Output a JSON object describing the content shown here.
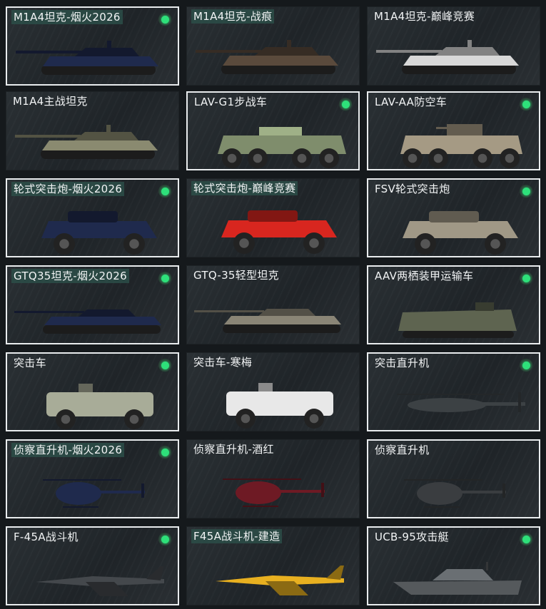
{
  "cards": [
    {
      "label": "M1A4坦克-烟火2026",
      "owned": true,
      "selected": true,
      "highlight": true,
      "icon": "tank-icon",
      "skin": "firework",
      "accent": "#1f2a4d"
    },
    {
      "label": "M1A4坦克-战痕",
      "owned": false,
      "selected": false,
      "highlight": true,
      "icon": "tank-icon",
      "skin": "battlescar",
      "accent": "#5a4a3c"
    },
    {
      "label": "M1A4坦克-巅峰竞赛",
      "owned": false,
      "selected": false,
      "highlight": false,
      "icon": "tank-icon",
      "skin": "race",
      "accent": "#d8d8d8"
    },
    {
      "label": "M1A4主战坦克",
      "owned": false,
      "selected": false,
      "highlight": false,
      "icon": "tank-icon",
      "skin": "default",
      "accent": "#8a8a70"
    },
    {
      "label": "LAV-G1步战车",
      "owned": true,
      "selected": true,
      "highlight": false,
      "icon": "ifv-icon",
      "skin": "default",
      "accent": "#7f8d6c"
    },
    {
      "label": "LAV-AA防空车",
      "owned": true,
      "selected": true,
      "highlight": false,
      "icon": "aa-vehicle-icon",
      "skin": "default",
      "accent": "#a59a84"
    },
    {
      "label": "轮式突击炮-烟火2026",
      "owned": true,
      "selected": true,
      "highlight": true,
      "icon": "armored-car-icon",
      "skin": "firework",
      "accent": "#1f2a4d"
    },
    {
      "label": "轮式突击炮-巅峰竞赛",
      "owned": false,
      "selected": false,
      "highlight": true,
      "icon": "armored-car-icon",
      "skin": "race",
      "accent": "#d8261f"
    },
    {
      "label": "FSV轮式突击炮",
      "owned": true,
      "selected": true,
      "highlight": false,
      "icon": "armored-car-icon",
      "skin": "default",
      "accent": "#a09886"
    },
    {
      "label": "GTQ35坦克-烟火2026",
      "owned": true,
      "selected": true,
      "highlight": true,
      "icon": "light-tank-icon",
      "skin": "firework",
      "accent": "#1f2a4d"
    },
    {
      "label": "GTQ-35轻型坦克",
      "owned": false,
      "selected": false,
      "highlight": false,
      "icon": "light-tank-icon",
      "skin": "default",
      "accent": "#8a8576"
    },
    {
      "label": "AAV两栖装甲运输车",
      "owned": true,
      "selected": true,
      "highlight": false,
      "icon": "amphibious-vehicle-icon",
      "skin": "default",
      "accent": "#5e6450"
    },
    {
      "label": "突击车",
      "owned": true,
      "selected": true,
      "highlight": false,
      "icon": "assault-vehicle-icon",
      "skin": "default",
      "accent": "#a8ac98"
    },
    {
      "label": "突击车-寒梅",
      "owned": false,
      "selected": false,
      "highlight": false,
      "icon": "assault-vehicle-icon",
      "skin": "plum",
      "accent": "#e8e8e8"
    },
    {
      "label": "突击直升机",
      "owned": true,
      "selected": true,
      "highlight": false,
      "icon": "attack-helicopter-icon",
      "skin": "default",
      "accent": "#3c4144"
    },
    {
      "label": "侦察直升机-烟火2026",
      "owned": true,
      "selected": true,
      "highlight": true,
      "icon": "scout-helicopter-icon",
      "skin": "firework",
      "accent": "#1f2a4d"
    },
    {
      "label": "侦察直升机-酒红",
      "owned": false,
      "selected": false,
      "highlight": false,
      "icon": "scout-helicopter-icon",
      "skin": "wine",
      "accent": "#6e1a24"
    },
    {
      "label": "侦察直升机",
      "owned": false,
      "selected": true,
      "highlight": false,
      "icon": "scout-helicopter-icon",
      "skin": "default",
      "accent": "#3a3d40"
    },
    {
      "label": "F-45A战斗机",
      "owned": true,
      "selected": true,
      "highlight": false,
      "icon": "fighter-jet-icon",
      "skin": "default",
      "accent": "#44484c"
    },
    {
      "label": "F45A战斗机-建造",
      "owned": false,
      "selected": false,
      "highlight": true,
      "icon": "fighter-jet-icon",
      "skin": "construction",
      "accent": "#e8b020"
    },
    {
      "label": "UCB-95攻击艇",
      "owned": true,
      "selected": true,
      "highlight": false,
      "icon": "attack-boat-icon",
      "skin": "default",
      "accent": "#55595c"
    }
  ]
}
